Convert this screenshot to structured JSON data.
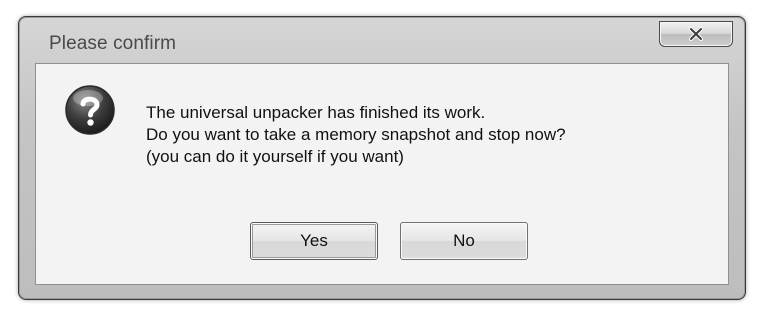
{
  "dialog": {
    "title": "Please confirm",
    "close_icon": "close-x-icon",
    "message_icon": "question-mark-icon",
    "message_lines": [
      "The universal unpacker has finished its work.",
      "Do you want to take a memory snapshot and stop now?",
      "(you can do it yourself if you want)"
    ],
    "buttons": {
      "yes_label": "Yes",
      "no_label": "No"
    }
  }
}
